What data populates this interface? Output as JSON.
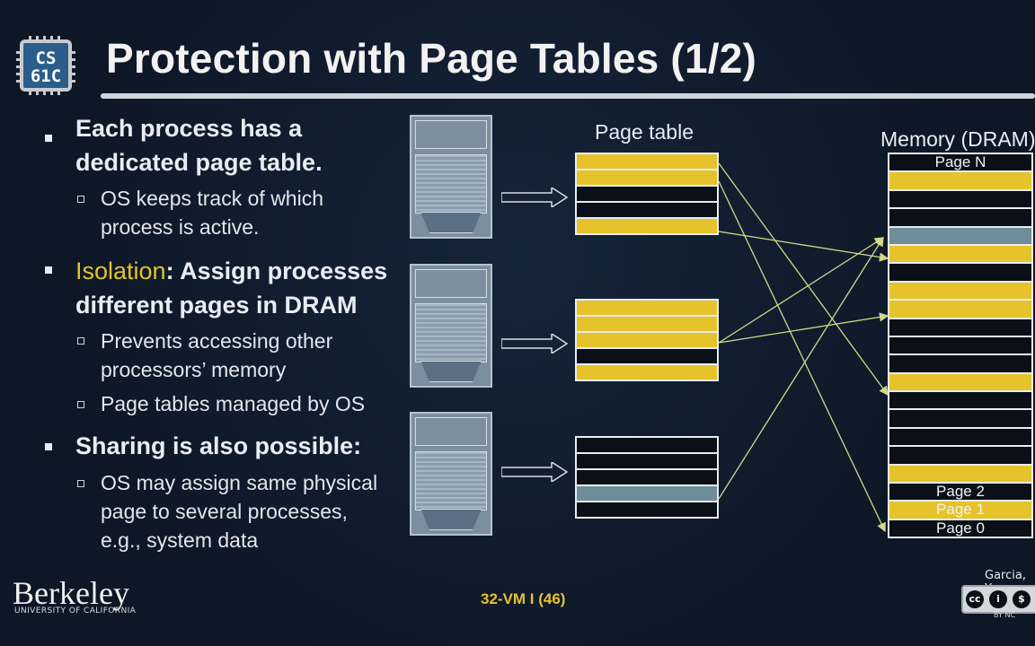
{
  "logo": {
    "line1": "CS",
    "line2": "61C"
  },
  "title": "Protection with Page Tables (1/2)",
  "bullets": [
    {
      "text_line1": "Each process has a",
      "text_line2": "dedicated page table.",
      "sub": [
        {
          "line1": "OS keeps track of which",
          "line2": "process is active."
        }
      ]
    },
    {
      "highlight": "Isolation",
      "rest1": ": Assign processes",
      "text_line2": "different pages in DRAM",
      "sub": [
        {
          "line1": "Prevents accessing other",
          "line2": "processors’ memory"
        },
        {
          "line1": "Page tables managed by OS",
          "line2": ""
        }
      ]
    },
    {
      "text_line1": "Sharing is also possible:",
      "sub": [
        {
          "line1": "OS may assign same physical",
          "line2": "page to several processes,",
          "line3": "e.g., system data"
        }
      ]
    }
  ],
  "diagram": {
    "page_table_label": "Page table",
    "memory_label": "Memory (DRAM)",
    "memory_pages": {
      "top": "Page N",
      "p2": "Page 2",
      "p1": "Page 1",
      "p0": "Page 0"
    },
    "colors": {
      "yellow": "#e6c32a",
      "gray": "#6f8c9a",
      "black": "#0b0f18",
      "arrow": "#cfd98a"
    }
  },
  "footer": {
    "institution": "Berkeley",
    "institution_sub": "UNIVERSITY OF CALIFORNIA",
    "slide": "32-VM I (46)",
    "author": "Garcia, Yo",
    "license": "BY NC"
  }
}
